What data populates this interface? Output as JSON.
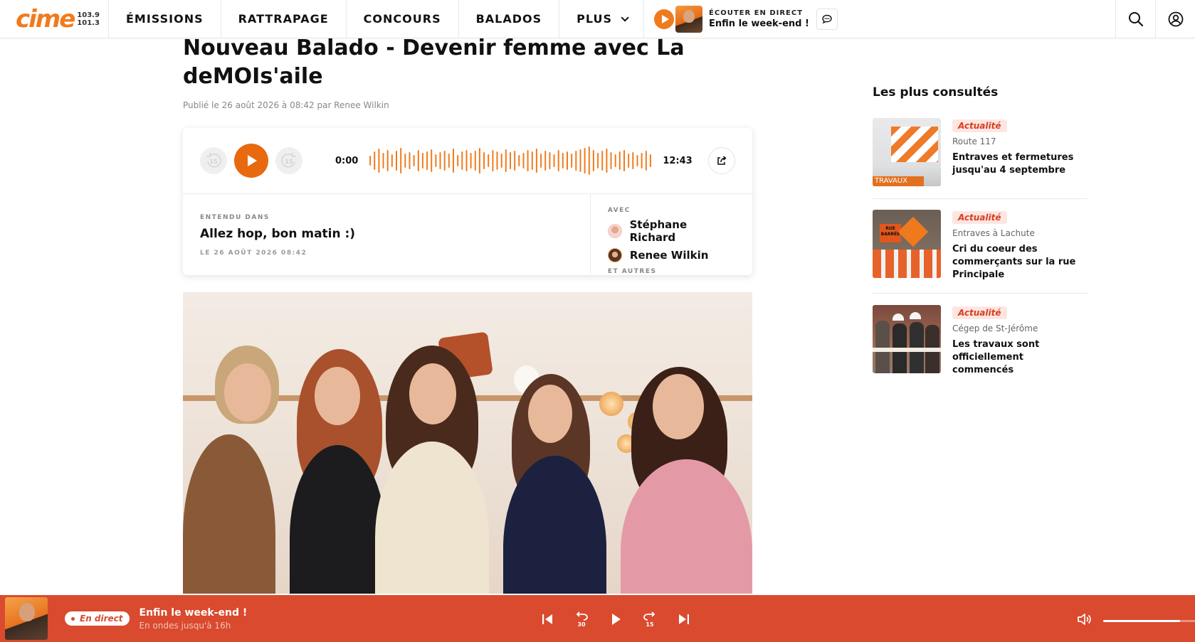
{
  "brand": {
    "logo_text": "cime",
    "freq_1": "103.9",
    "freq_2": "101.3",
    "accent": "#f07b1d",
    "live_red": "#d94a2e"
  },
  "nav": {
    "items": [
      "ÉMISSIONS",
      "RATTRAPAGE",
      "CONCOURS",
      "BALADOS",
      "PLUS"
    ],
    "live_kicker": "ÉCOUTER EN DIRECT",
    "live_show": "Enfin le week-end !",
    "icons": [
      "play-icon",
      "chat-icon",
      "search-icon",
      "user-icon"
    ]
  },
  "article": {
    "title": "Nouveau Balado - Devenir femme avec La deMOIs'aile",
    "byline": "Publié le 26 août 2026 à 08:42 par Renee Wilkin"
  },
  "player": {
    "current_time": "0:00",
    "duration": "12:43",
    "progress": 0,
    "heard_kicker": "ENTENDU DANS",
    "heard_show": "Allez hop, bon matin :)",
    "heard_date": "LE 26 AOÛT 2026 08:42",
    "with_kicker": "AVEC",
    "hosts": [
      "Stéphane Richard",
      "Renee Wilkin"
    ],
    "others": "ET AUTRES",
    "skip_back": "15",
    "skip_fwd": "15"
  },
  "sidebar": {
    "title": "Les plus consultés",
    "cards": [
      {
        "tag": "Actualité",
        "sub": "Route 117",
        "headline": "Entraves et fermetures jusqu'au 4 septembre",
        "thumb_caption": "TRAVAUX"
      },
      {
        "tag": "Actualité",
        "sub": "Entraves à Lachute",
        "headline": "Cri du coeur des commerçants sur la rue Principale",
        "thumb_caption": "RUE BARRÉE"
      },
      {
        "tag": "Actualité",
        "sub": "Cégep de St-Jérôme",
        "headline": "Les travaux sont officiellement commencés",
        "thumb_caption": ""
      }
    ]
  },
  "bottom_bar": {
    "badge": "En direct",
    "show": "Enfin le week-end !",
    "sub": "En ondes jusqu'à 16h",
    "rewind": "30",
    "forward": "15",
    "volume": 0.75
  }
}
